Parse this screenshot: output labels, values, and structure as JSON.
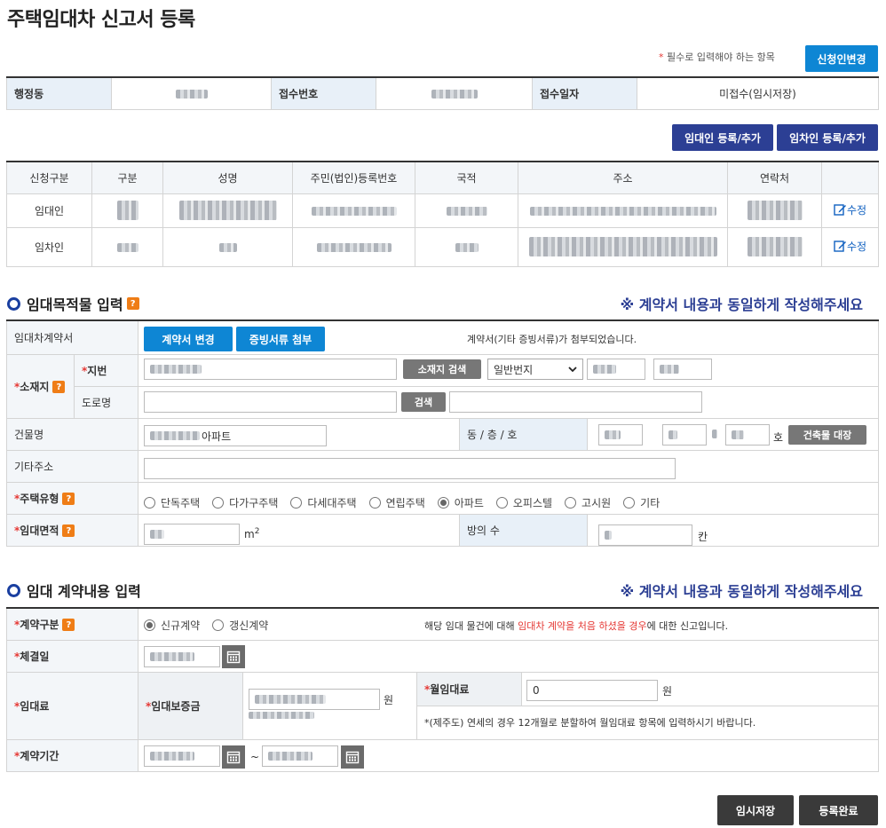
{
  "page": {
    "title": "주택임대차 신고서 등록",
    "required_note": "필수로 입력해야 하는 항목",
    "required_star": "*"
  },
  "buttons": {
    "change_applicant": "신청인변경",
    "add_lessor": "임대인 등록/추가",
    "add_lessee": "임차인 등록/추가",
    "change_contract": "계약서 변경",
    "attach_evidence": "증빙서류 첨부",
    "location_search": "소재지 검색",
    "search": "검색",
    "building_register": "건축물 대장",
    "temp_save": "임시저장",
    "complete": "등록완료"
  },
  "summary": {
    "labels": [
      "행정동",
      "접수번호",
      "접수일자"
    ],
    "receipt_date_value": "미접수(임시저장)"
  },
  "parties": {
    "headers": [
      "신청구분",
      "구분",
      "성명",
      "주민(법인)등록번호",
      "국적",
      "주소",
      "연락처",
      ""
    ],
    "rows": [
      {
        "type": "임대인",
        "edit": "수정"
      },
      {
        "type": "임차인",
        "edit": "수정"
      }
    ]
  },
  "property": {
    "section_title": "임대목적물 입력",
    "section_note": "※ 계약서 내용과 동일하게 작성해주세요",
    "contract_label": "임대차계약서",
    "contract_status": "계약서(기타 증빙서류)가 첨부되었습니다.",
    "location_label": "소재지",
    "lot_label": "지번",
    "road_label": "도로명",
    "lot_type_selected": "일반번지",
    "building_label": "건물명",
    "building_value": "아파트",
    "dong_floor_ho_label": "동 / 층 / 호",
    "ho_unit": "호",
    "other_address_label": "기타주소",
    "housing_type_label": "주택유형",
    "housing_types": [
      "단독주택",
      "다가구주택",
      "다세대주택",
      "연립주택",
      "아파트",
      "오피스텔",
      "고시원",
      "기타"
    ],
    "housing_type_selected": 4,
    "area_label": "임대면적",
    "area_unit": "m",
    "area_unit_sup": "2",
    "rooms_label": "방의 수",
    "rooms_unit": "칸"
  },
  "contract": {
    "section_title": "임대 계약내용 입력",
    "section_note": "※ 계약서 내용과 동일하게 작성해주세요",
    "type_label": "계약구분",
    "types": [
      "신규계약",
      "갱신계약"
    ],
    "type_selected": 0,
    "type_note_pre": "해당 임대 물건에 대해 ",
    "type_note_red": "임대차 계약을 처음 하셨을 경우",
    "type_note_post": "에 대한 신고입니다.",
    "date_label": "체결일",
    "rent_label": "임대료",
    "deposit_label": "임대보증금",
    "won": "원",
    "monthly_label": "월임대료",
    "monthly_value": "0",
    "jeju_note": "*(제주도) 연세의 경우 12개월로 분할하여 월임대료 항목에 입력하시기 바랍니다.",
    "period_label": "계약기간",
    "tilde": "~"
  }
}
